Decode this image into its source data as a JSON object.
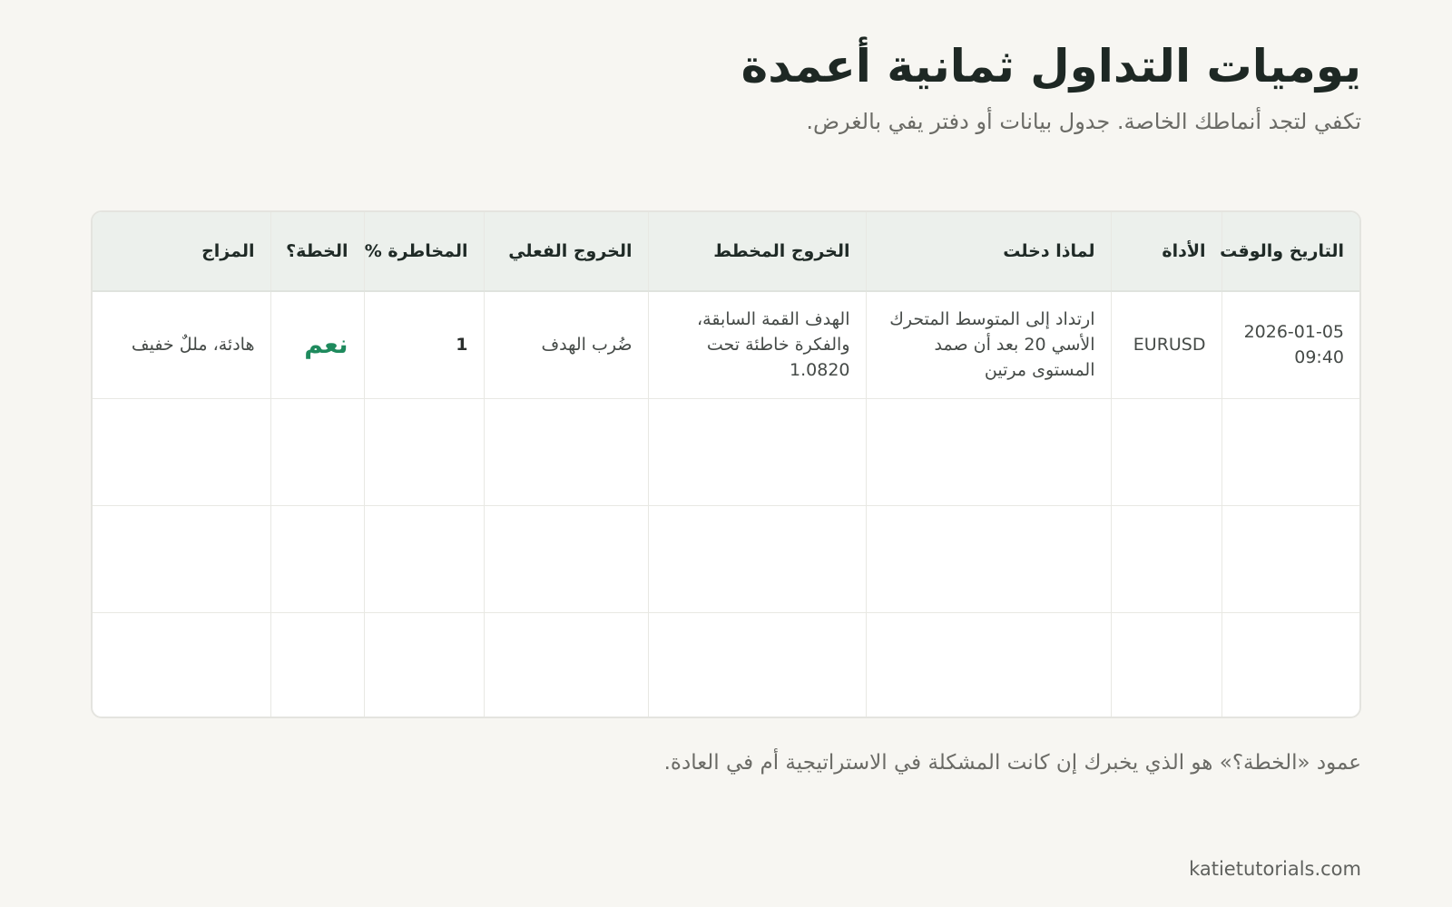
{
  "title": "يوميات التداول ثمانية أعمدة",
  "subtitle": "تكفي لتجد أنماطك الخاصة. جدول بيانات أو دفتر يفي بالغرض.",
  "table": {
    "headers": [
      "التاريخ والوقت",
      "الأداة",
      "لماذا دخلت",
      "الخروج المخطط",
      "الخروج الفعلي",
      "المخاطرة %",
      "الخطة؟",
      "المزاج"
    ],
    "rows": [
      {
        "datetime": "2026-01-05 09:40",
        "instrument": "EURUSD",
        "reason": "ارتداد إلى المتوسط المتحرك الأسي 20 بعد أن صمد المستوى مرتين",
        "planned_exit": "الهدف القمة السابقة، والفكرة خاطئة تحت 1.0820",
        "actual_exit": "ضُرب الهدف",
        "risk": "1",
        "plan": "نعم",
        "mood": "هادئة، مللٌ خفيف"
      }
    ],
    "empty_rows": 3
  },
  "note": "عمود «الخطة؟» هو الذي يخبرك إن كانت المشكلة في الاستراتيجية أم في العادة.",
  "footer": "katietutorials.com",
  "colors": {
    "background": "#f7f6f2",
    "header_bg": "#ecf0ec",
    "plan_yes": "#1e8a5d",
    "text": "#1f2a26",
    "muted": "#6b6b66"
  }
}
